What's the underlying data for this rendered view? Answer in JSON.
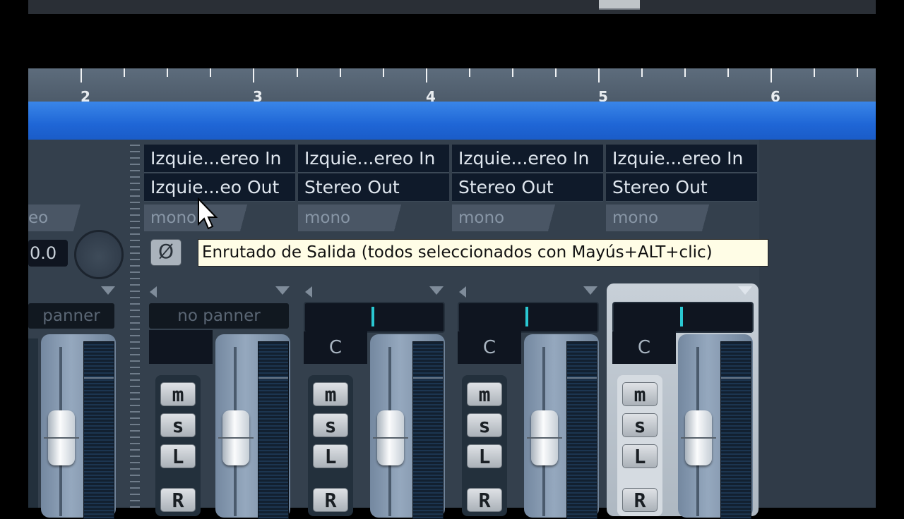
{
  "ruler": {
    "numbers": [
      "2",
      "3",
      "4",
      "5",
      "6"
    ]
  },
  "mixer": {
    "left_partial": {
      "mono_label": "eo",
      "value": "0.0",
      "panner": "panner"
    },
    "channels": [
      {
        "input": "Izquie...ereo In",
        "output": "Izquie...eo Out",
        "mono": "mono",
        "panner": "no panner",
        "pan_label": "",
        "buttons": [
          "m",
          "s",
          "L",
          "R"
        ]
      },
      {
        "input": "Izquie...ereo In",
        "output": "Stereo Out",
        "mono": "mono",
        "panner": "",
        "pan_label": "C",
        "buttons": [
          "m",
          "s",
          "L",
          "R"
        ]
      },
      {
        "input": "Izquie...ereo In",
        "output": "Stereo Out",
        "mono": "mono",
        "panner": "",
        "pan_label": "C",
        "buttons": [
          "m",
          "s",
          "L",
          "R"
        ]
      },
      {
        "input": "Izquie...ereo In",
        "output": "Stereo Out",
        "mono": "mono",
        "panner": "",
        "pan_label": "C",
        "buttons": [
          "m",
          "s",
          "L",
          "R"
        ]
      }
    ],
    "phase_symbol": "Ø",
    "tooltip": "Enrutado de Salida (todos seleccionados con Mayús+ALT+clic)"
  },
  "colors": {
    "cycle_bar": "#1f66d6",
    "pan_cursor": "#2ac8d2",
    "tooltip_bg": "#fffde6"
  }
}
